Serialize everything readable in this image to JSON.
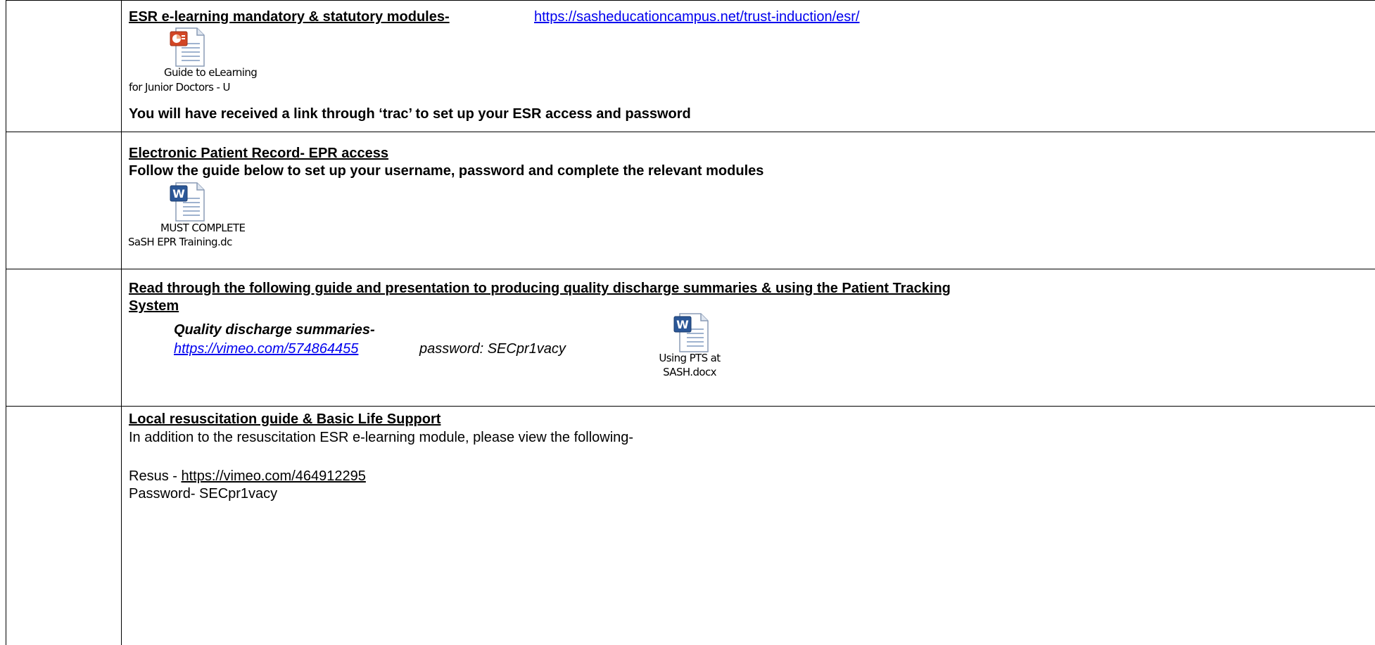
{
  "rows": [
    {
      "heading": "ESR e-learning mandatory & statutory modules-",
      "link": "https://sasheducationcampus.net/trust-induction/esr/",
      "attachment": {
        "icon": "powerpoint-file-icon",
        "caption_line1": "Guide to eLearning",
        "caption_line2": "for Junior Doctors - U"
      },
      "note": "You will have received a link through ‘trac’ to set up your ESR access and password"
    },
    {
      "heading": "Electronic Patient Record- EPR access",
      "subheading": "Follow the guide below to set up your username, password and complete the relevant modules",
      "attachment": {
        "icon": "word-file-icon",
        "caption_line1": "MUST COMPLETE",
        "caption_line2": "SaSH EPR Training.dc"
      }
    },
    {
      "heading_line1": "Read through the following guide and presentation to producing quality discharge summaries & using the Patient Tracking",
      "heading_line2": "System",
      "item_title": "Quality discharge summaries-",
      "item_link": "https://vimeo.com/574864455",
      "item_password": "password: SECpr1vacy",
      "attachment": {
        "icon": "word-file-icon",
        "caption_line1": "Using PTS at",
        "caption_line2": "SASH.docx"
      }
    },
    {
      "heading": "Local resuscitation guide & Basic Life Support",
      "intro": "In addition to the resuscitation ESR e-learning module, please view the following-",
      "resus_label": "Resus - ",
      "resus_link": "https://vimeo.com/464912295",
      "password_line": "Password- SECpr1vacy"
    }
  ],
  "colors": {
    "link": "#0000ee",
    "border": "#000000",
    "ppt_icon": "#d24625",
    "word_icon": "#2b5797"
  }
}
